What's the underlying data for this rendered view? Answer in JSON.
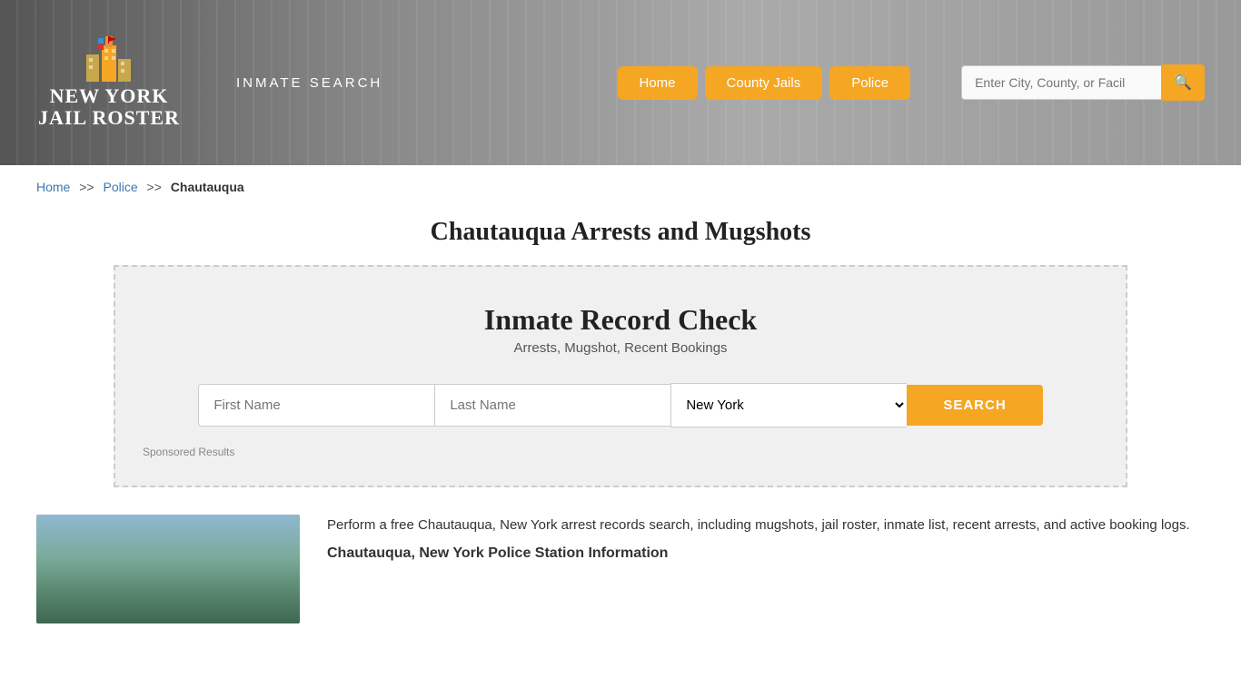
{
  "header": {
    "logo_line1": "NEW YORK",
    "logo_line2": "JAIL ROSTER",
    "inmate_search_label": "INMATE SEARCH",
    "nav": [
      {
        "label": "Home",
        "id": "home"
      },
      {
        "label": "County Jails",
        "id": "county-jails"
      },
      {
        "label": "Police",
        "id": "police"
      }
    ],
    "search_placeholder": "Enter City, County, or Facil"
  },
  "breadcrumb": {
    "home": "Home",
    "sep1": ">>",
    "police": "Police",
    "sep2": ">>",
    "current": "Chautauqua"
  },
  "page_title": "Chautauqua Arrests and Mugshots",
  "inmate_record": {
    "title": "Inmate Record Check",
    "subtitle": "Arrests, Mugshot, Recent Bookings",
    "first_name_placeholder": "First Name",
    "last_name_placeholder": "Last Name",
    "state_value": "New York",
    "search_button": "SEARCH",
    "sponsored_label": "Sponsored Results"
  },
  "bottom": {
    "description": "Perform a free Chautauqua, New York arrest records search, including mugshots, jail roster, inmate list, recent arrests, and active booking logs.",
    "section_heading": "Chautauqua, New York Police Station Information"
  }
}
